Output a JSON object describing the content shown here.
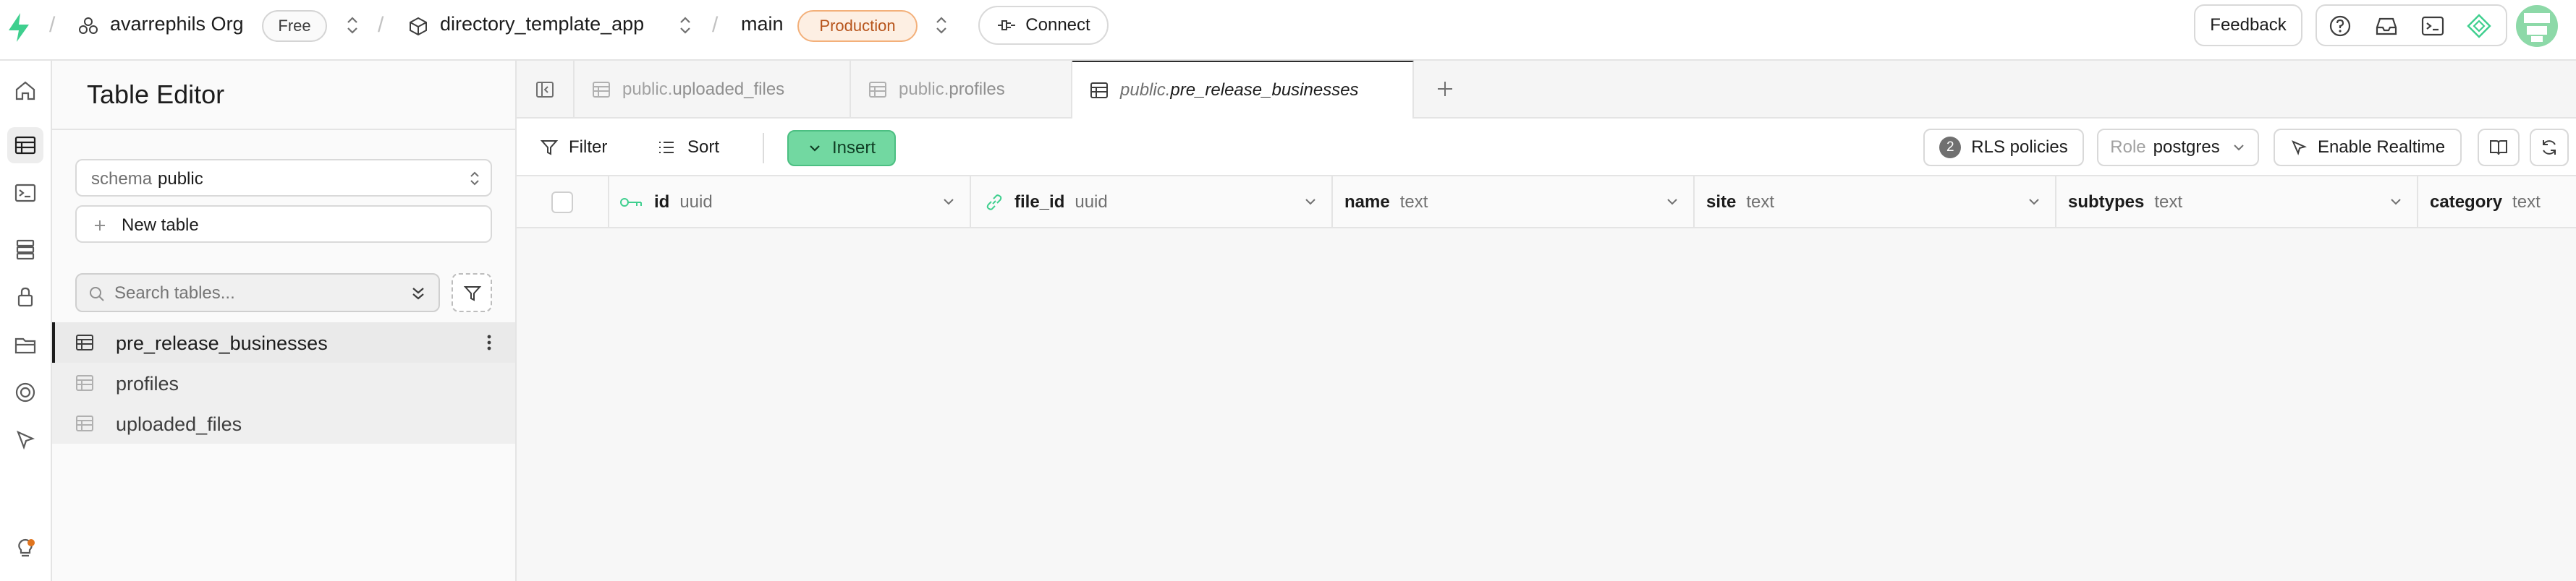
{
  "topbar": {
    "org_name": "avarrephils Org",
    "plan_badge": "Free",
    "project_name": "directory_template_app",
    "branch_name": "main",
    "env_badge": "Production",
    "connect_label": "Connect",
    "feedback_label": "Feedback",
    "icons": [
      "help-icon",
      "inbox-icon",
      "terminal-icon",
      "assistant-icon",
      "avatar"
    ]
  },
  "rail": {
    "items": [
      "home-icon",
      "table-editor-icon",
      "sql-editor-icon",
      "database-icon",
      "auth-icon",
      "storage-icon",
      "realtime-icon",
      "edge-functions-icon",
      "advisors-icon"
    ]
  },
  "sidebar": {
    "title": "Table Editor",
    "schema_label": "schema",
    "schema_value": "public",
    "new_table_label": "New table",
    "search_placeholder": "Search tables...",
    "tables": [
      {
        "name": "pre_release_businesses",
        "active": true
      },
      {
        "name": "profiles",
        "active": false
      },
      {
        "name": "uploaded_files",
        "active": false
      }
    ]
  },
  "tabs": [
    {
      "schema": "public.",
      "name": "uploaded_files",
      "active": false
    },
    {
      "schema": "public.",
      "name": "profiles",
      "active": false
    },
    {
      "schema": "public.",
      "name": "pre_release_businesses",
      "active": true
    }
  ],
  "toolbar": {
    "filter_label": "Filter",
    "sort_label": "Sort",
    "insert_label": "Insert",
    "rls_count": "2",
    "rls_label": "RLS policies",
    "role_label": "Role",
    "role_value": "postgres",
    "realtime_label": "Enable Realtime"
  },
  "columns": [
    {
      "name": "id",
      "type": "uuid",
      "icon": "primary-key-icon"
    },
    {
      "name": "file_id",
      "type": "uuid",
      "icon": "foreign-key-link-icon"
    },
    {
      "name": "name",
      "type": "text"
    },
    {
      "name": "site",
      "type": "text"
    },
    {
      "name": "subtypes",
      "type": "text"
    },
    {
      "name": "category",
      "type": "text"
    }
  ],
  "colors": {
    "brand_green": "#3ecf8e",
    "insert_green": "#72d8a1",
    "production_orange": "#b7541b"
  }
}
